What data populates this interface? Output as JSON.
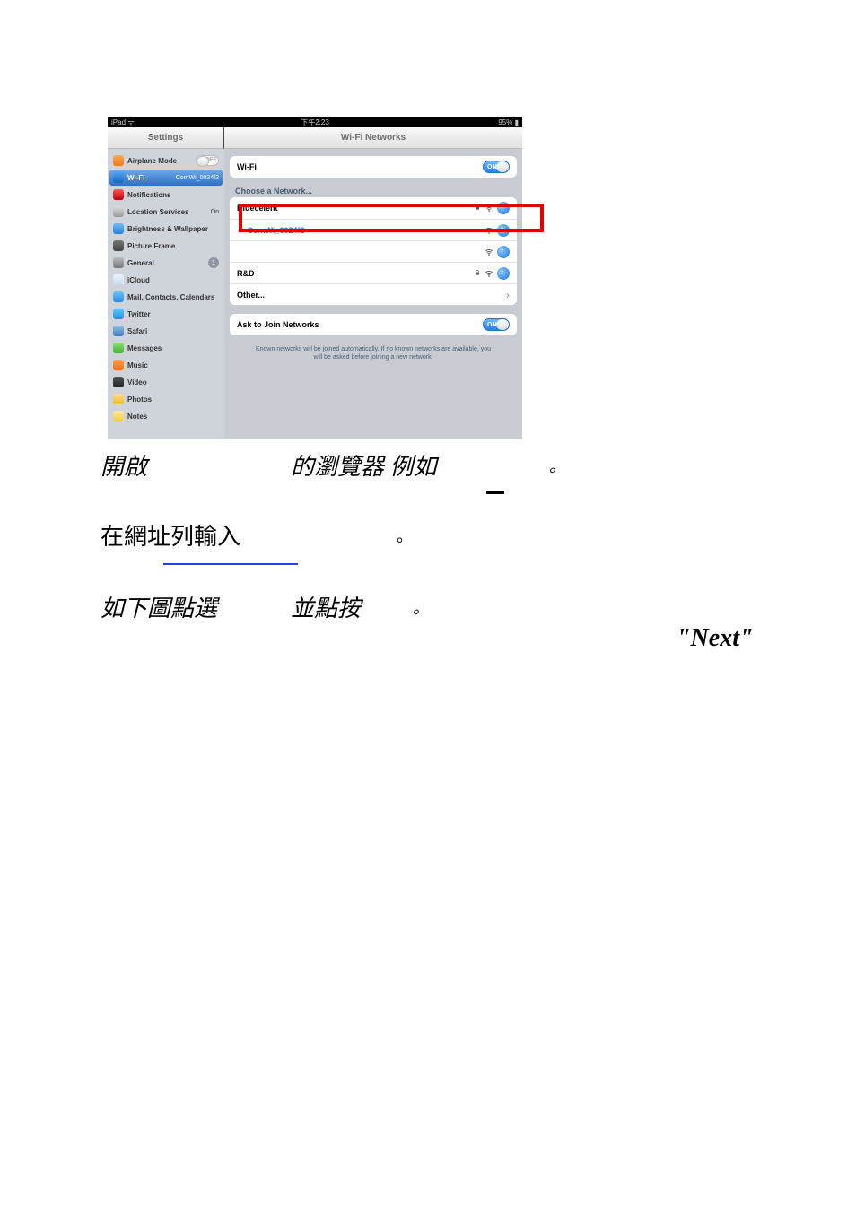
{
  "statusbar": {
    "left": "iPad ᯤ",
    "center": "下午2:23",
    "right": "95% ▮"
  },
  "titles": {
    "side": "Settings",
    "main": "Wi-Fi Networks"
  },
  "sidebar": {
    "items": [
      {
        "label": "Airplane Mode",
        "right_type": "toggle_off",
        "right": "OFF",
        "icon_bg": "linear-gradient(#ffa851,#f07b1e)"
      },
      {
        "label": "Wi-Fi",
        "right_type": "text",
        "right": "ComWi_0024f2",
        "icon_bg": "linear-gradient(#4ea5f2,#1565c0)",
        "selected": true
      },
      {
        "label": "Notifications",
        "right_type": "",
        "right": "",
        "icon_bg": "linear-gradient(#f55,#b00)"
      },
      {
        "label": "Location Services",
        "right_type": "text",
        "right": "On",
        "icon_bg": "linear-gradient(#ddd,#999)"
      },
      {
        "label": "Brightness & Wallpaper",
        "right_type": "",
        "right": "",
        "icon_bg": "linear-gradient(#6fbef4,#2a7fdc)"
      },
      {
        "label": "Picture Frame",
        "right_type": "",
        "right": "",
        "icon_bg": "linear-gradient(#777,#444)"
      },
      {
        "label": "General",
        "right_type": "badge",
        "right": "1",
        "icon_bg": "linear-gradient(#bbb,#777)"
      },
      {
        "label": "iCloud",
        "right_type": "",
        "right": "",
        "icon_bg": "linear-gradient(#eaf4ff,#c4d9ee)"
      },
      {
        "label": "Mail, Contacts, Calendars",
        "right_type": "",
        "right": "",
        "icon_bg": "linear-gradient(#6cc3ff,#2a8cdc)"
      },
      {
        "label": "Twitter",
        "right_type": "",
        "right": "",
        "icon_bg": "linear-gradient(#66c6ff,#1b8fe0)"
      },
      {
        "label": "Safari",
        "right_type": "",
        "right": "",
        "icon_bg": "linear-gradient(#8fbfe8,#3d7cbf)"
      },
      {
        "label": "Messages",
        "right_type": "",
        "right": "",
        "icon_bg": "linear-gradient(#8fe27a,#3fb32b)"
      },
      {
        "label": "Music",
        "right_type": "",
        "right": "",
        "icon_bg": "linear-gradient(#ff9f4a,#f06a1e)"
      },
      {
        "label": "Video",
        "right_type": "",
        "right": "",
        "icon_bg": "linear-gradient(#555,#222)"
      },
      {
        "label": "Photos",
        "right_type": "",
        "right": "",
        "icon_bg": "linear-gradient(#ffe08a,#f0b82a)"
      },
      {
        "label": "Notes",
        "right_type": "",
        "right": "",
        "icon_bg": "linear-gradient(#ffe89a,#f0cf4a)"
      }
    ]
  },
  "detail": {
    "wifi_label": "Wi-Fi",
    "wifi_on": "ON",
    "choose_label": "Choose a Network...",
    "networks": [
      {
        "name": "Bluecelent",
        "locked": true,
        "checked": false
      },
      {
        "name": "ComWi_0024f2",
        "locked": false,
        "checked": true
      },
      {
        "name": "",
        "locked": false,
        "checked": false
      },
      {
        "name": "R&D",
        "locked": true,
        "checked": false
      }
    ],
    "other_label": "Other...",
    "ask_label": "Ask to Join Networks",
    "ask_on": "ON",
    "hint1": "Known networks will be joined automatically. If no known networks are available, you",
    "hint2": "will be asked before joining a new network."
  },
  "doc": {
    "line1a": "開啟",
    "line1b": "的瀏覽器 例如",
    "line1c": "。",
    "line2a": "在網址列輸入",
    "line2b": "。",
    "line3a": "如下圖點選",
    "line3b": "並點按",
    "line3c": "。",
    "next": "\"Next\""
  }
}
